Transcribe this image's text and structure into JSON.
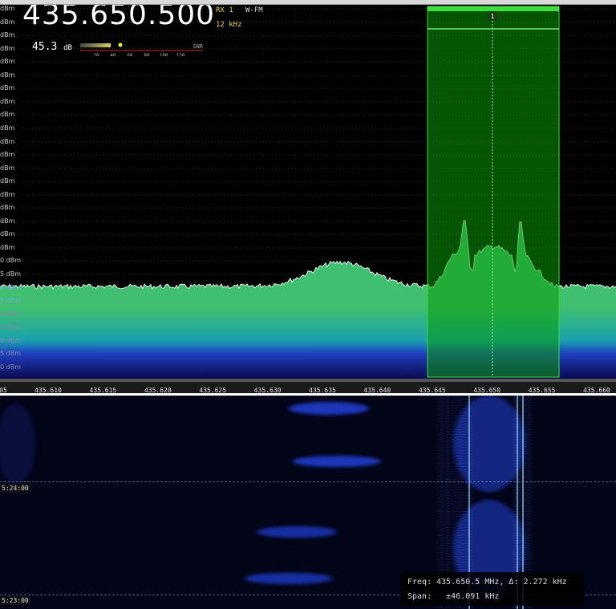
{
  "vfo": {
    "frequency": "435.650.500",
    "receiver": "RX 1",
    "mode": "W-FM",
    "bandwidth": "12 kHz"
  },
  "snr": {
    "value": "45.3",
    "unit": "dB",
    "label": "SNR",
    "scale": [
      "20",
      "40",
      "60",
      "80",
      "100",
      "120"
    ],
    "level_db": 45.3
  },
  "vfo_marker": {
    "label": "1"
  },
  "y_axis_labels": [
    "dBm",
    "dBm",
    "dBm",
    "dBm",
    "dBm",
    "dBm",
    "dBm",
    "dBm",
    "dBm",
    "dBm",
    "dBm",
    "dBm",
    "dBm",
    "dBm",
    "dBm",
    "dBm",
    "dBm",
    "dBm",
    "dBm",
    "0 dBm",
    "5 dBm",
    "0 dBm",
    "5 dBm",
    "0 dBm",
    "5 dBm",
    "0 dBm",
    "5 dBm",
    "0 dBm"
  ],
  "x_axis_labels": [
    "05",
    "435.610",
    "435.615",
    "435.620",
    "435.625",
    "435.630",
    "435.635",
    "435.640",
    "435.645",
    "435.650",
    "435.655",
    "435.660"
  ],
  "waterfall": {
    "time_labels": [
      "5:24:00",
      "5:23:00"
    ]
  },
  "readout": {
    "freq_line": "Freq: 435.650.5 MHz, Δ: 2.272 kHz",
    "span_line": "Span:   ±46.091 kHz"
  },
  "colors": {
    "filter_green": "#0a7a0a",
    "spectrum_top": "#3fbf6f",
    "waterfall_signal": "#2a4dff"
  }
}
